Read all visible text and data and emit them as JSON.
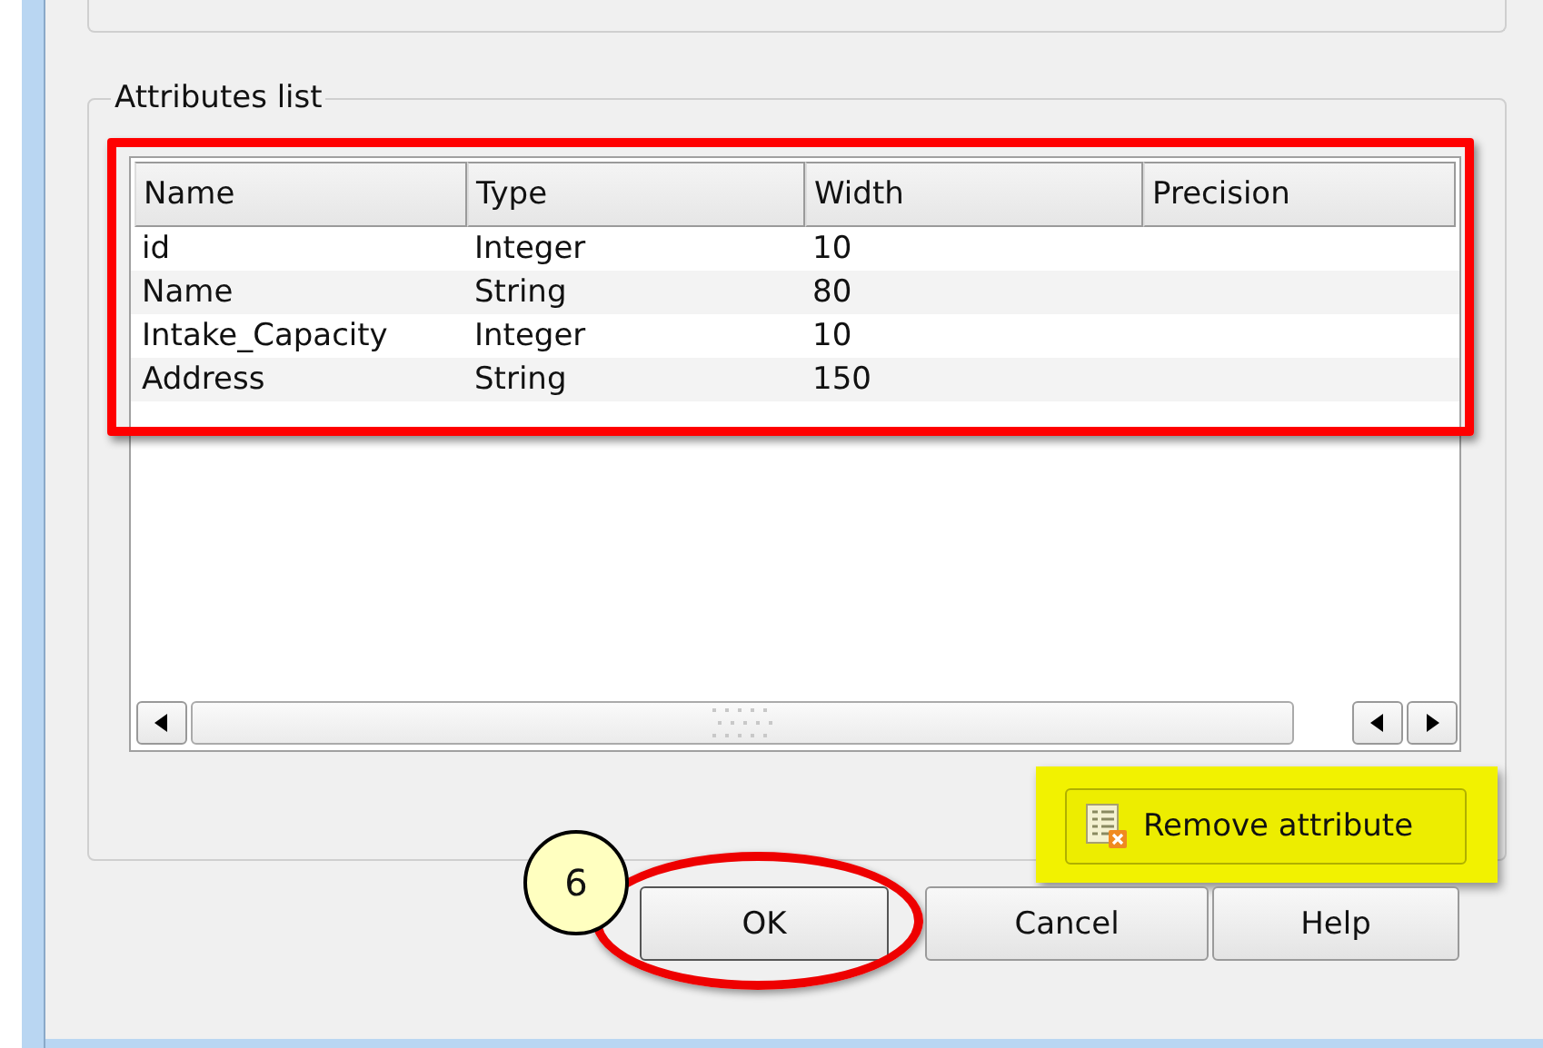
{
  "group": {
    "title": "Attributes list"
  },
  "table": {
    "highlighted": true,
    "columns": [
      "Name",
      "Type",
      "Width",
      "Precision"
    ],
    "rows": [
      {
        "cells": [
          "id",
          "Integer",
          "10",
          ""
        ]
      },
      {
        "cells": [
          "Name",
          "String",
          "80",
          ""
        ]
      },
      {
        "cells": [
          "Intake_Capacity",
          "Integer",
          "10",
          ""
        ]
      },
      {
        "cells": [
          "Address",
          "String",
          "150",
          ""
        ]
      }
    ]
  },
  "remove_button": {
    "label": "Remove attribute",
    "highlighted": true
  },
  "callout": {
    "label": "6"
  },
  "buttons": [
    {
      "label": "OK",
      "highlighted": true
    },
    {
      "label": "Cancel",
      "highlighted": false
    },
    {
      "label": "Help",
      "highlighted": false
    }
  ]
}
